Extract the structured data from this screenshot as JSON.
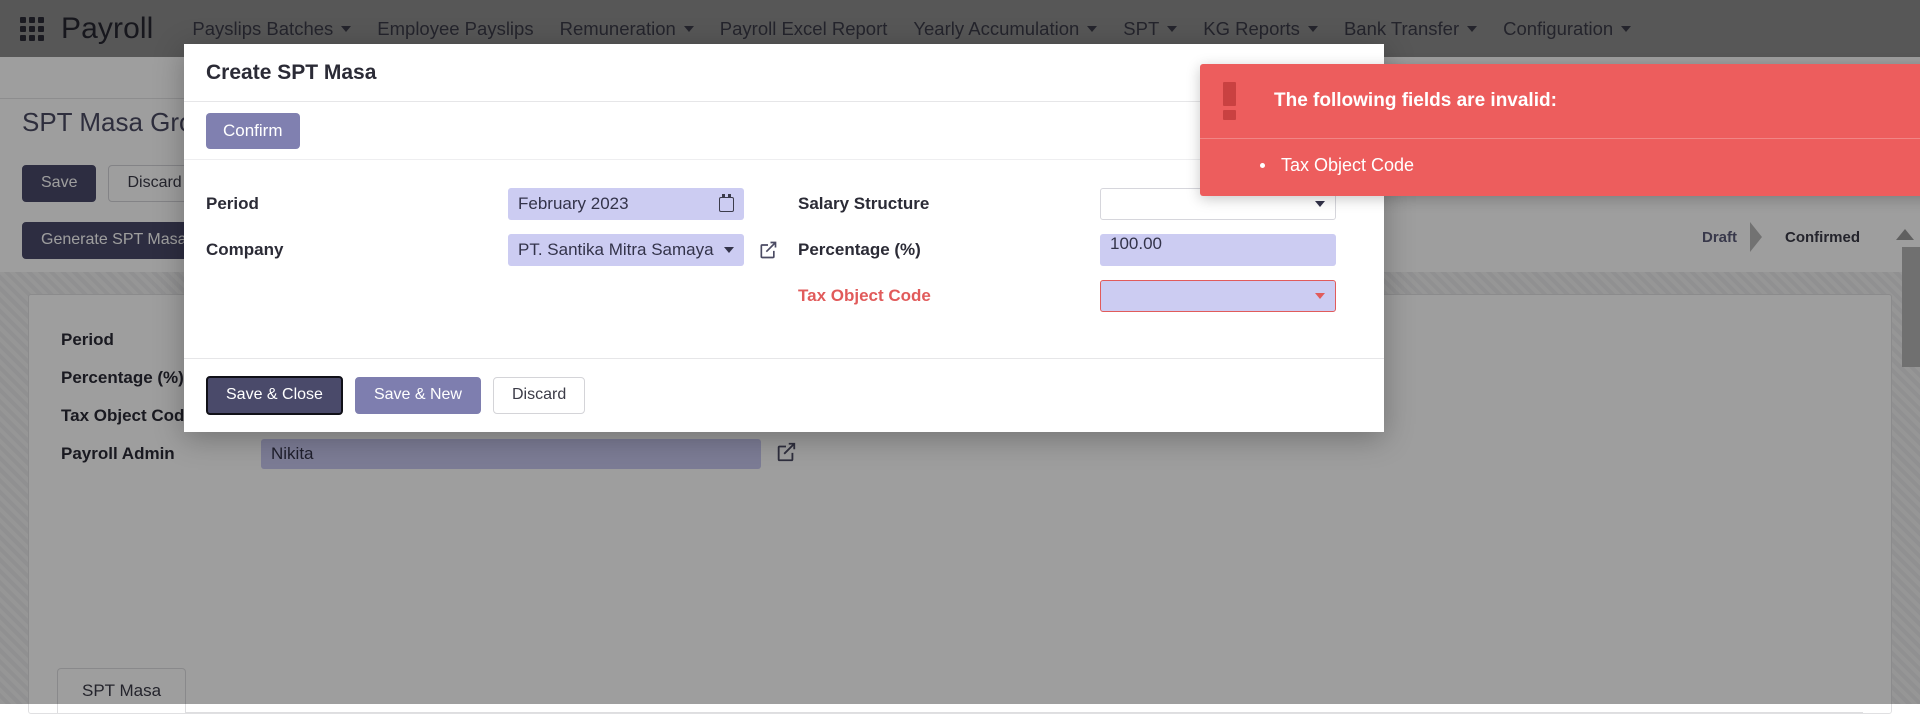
{
  "navbar": {
    "apps_icon": "apps-grid-icon",
    "brand": "Payroll",
    "items": [
      {
        "label": "Payslips Batches",
        "has_caret": true
      },
      {
        "label": "Employee Payslips",
        "has_caret": false
      },
      {
        "label": "Remuneration",
        "has_caret": true
      },
      {
        "label": "Payroll Excel Report",
        "has_caret": false
      },
      {
        "label": "Yearly Accumulation",
        "has_caret": true
      },
      {
        "label": "SPT",
        "has_caret": true
      },
      {
        "label": "KG Reports",
        "has_caret": true
      },
      {
        "label": "Bank Transfer",
        "has_caret": true
      },
      {
        "label": "Configuration",
        "has_caret": true
      }
    ]
  },
  "background_page": {
    "title": "SPT Masa Group",
    "save_label": "Save",
    "discard_label": "Discard",
    "generate_label": "Generate SPT Masa",
    "statusbar": [
      {
        "label": "Draft",
        "active": false
      },
      {
        "label": "Confirmed",
        "active": true
      }
    ],
    "form_rows": [
      {
        "label": "Period",
        "value": ""
      },
      {
        "label": "Percentage (%)",
        "value": ""
      },
      {
        "label": "Tax Object Code",
        "value": ""
      },
      {
        "label": "Payroll Admin",
        "value": "Nikita"
      }
    ],
    "tabs": [
      {
        "label": "SPT Masa"
      }
    ]
  },
  "modal": {
    "title": "Create SPT Masa",
    "close_icon": "close-icon",
    "confirm_label": "Confirm",
    "left_fields": [
      {
        "label": "Period",
        "value": "February  2023",
        "control": "month-input",
        "icon": "calendar-icon"
      },
      {
        "label": "Company",
        "value": "PT. Santika Mitra Samaya",
        "control": "select",
        "external_link_icon": "external-link-icon"
      }
    ],
    "right_fields": [
      {
        "label": "Salary Structure",
        "value": "",
        "control": "select",
        "invalid": false,
        "filled": false
      },
      {
        "label": "Percentage (%)",
        "value": "100.00",
        "control": "text-input",
        "invalid": false,
        "filled": true
      },
      {
        "label": "Tax Object Code",
        "value": "",
        "control": "select",
        "invalid": true,
        "filled": true
      }
    ],
    "footer": {
      "save_close_label": "Save & Close",
      "save_new_label": "Save & New",
      "discard_label": "Discard"
    }
  },
  "toast": {
    "icon": "exclamation-icon",
    "title": "The following fields are invalid:",
    "items": [
      "Tax Object Code"
    ]
  },
  "colors": {
    "accent": "#4a4a6a",
    "accent_light": "#8080b0",
    "field_fill": "#ccccf2",
    "error": "#ed5d5d",
    "navbar_bg": "#8d8d8d"
  }
}
